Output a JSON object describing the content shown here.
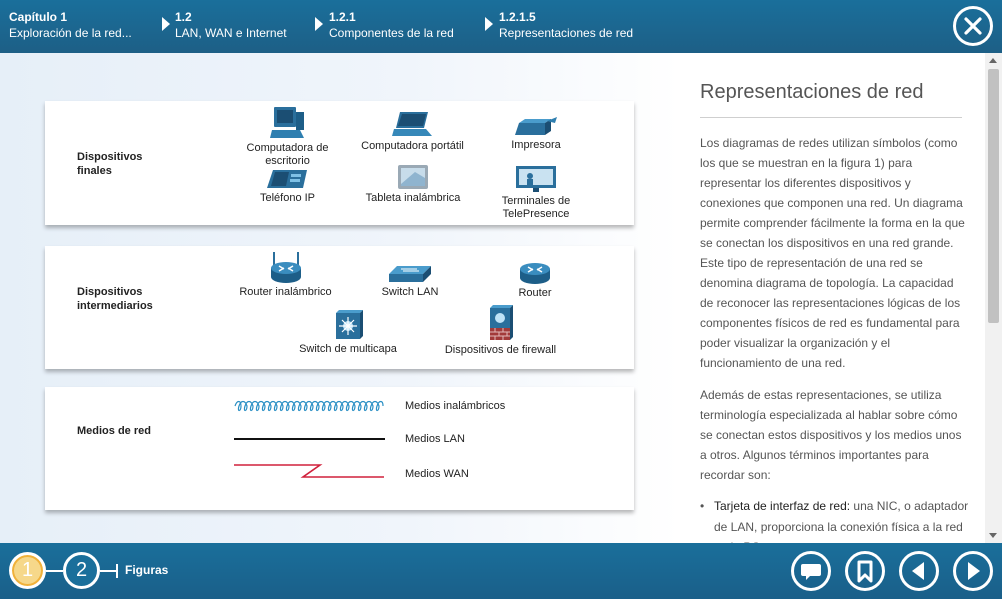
{
  "header": {
    "breadcrumbs": [
      {
        "num": "Capítulo 1",
        "label": "Exploración de la red..."
      },
      {
        "num": "1.2",
        "label": "LAN, WAN e Internet"
      },
      {
        "num": "1.2.1",
        "label": "Componentes de la red"
      },
      {
        "num": "1.2.1.5",
        "label": "Representaciones de red"
      }
    ],
    "close_icon": "close-icon"
  },
  "figure": {
    "end_devices": {
      "title": "Dispositivos finales",
      "items": [
        "Computadora de escritorio",
        "Computadora portátil",
        "Impresora",
        "Teléfono IP",
        "Tableta inalámbrica",
        "Terminales de TelePresence"
      ]
    },
    "intermediary_devices": {
      "title": "Dispositivos intermediarios",
      "items": [
        "Router inalámbrico",
        "Switch LAN",
        "Router",
        "Switch de multicapa",
        "Dispositivos de firewall"
      ]
    },
    "network_media": {
      "title": "Medios de red",
      "items": [
        "Medios inalámbricos",
        "Medios LAN",
        "Medios WAN"
      ]
    }
  },
  "article": {
    "title": "Representaciones de red",
    "paragraph1": "Los diagramas de redes utilizan símbolos (como los que se muestran en la figura 1) para representar los diferentes dispositivos y conexiones que componen una red. Un diagrama permite comprender fácilmente la forma en la que se conectan los dispositivos en una red grande. Este tipo de representación de una red se denomina diagrama de topología. La capacidad de reconocer las representaciones lógicas de los componentes físicos de red es fundamental para poder visualizar la organización y el funcionamiento de una red.",
    "paragraph2": "Además de estas representaciones, se utiliza terminología especializada al hablar sobre cómo se conectan estos dispositivos y los medios unos a otros. Algunos términos importantes para recordar son:",
    "list_term": "Tarjeta de interfaz de red:",
    "list_text": " una NIC, o adaptador de LAN, proporciona la conexión física a la red en la PC"
  },
  "footer": {
    "pages": [
      "1",
      "2"
    ],
    "figures_label": "Figuras",
    "colors": {
      "active_page": "#f6d88a",
      "bar": "#1a6f9b"
    }
  }
}
